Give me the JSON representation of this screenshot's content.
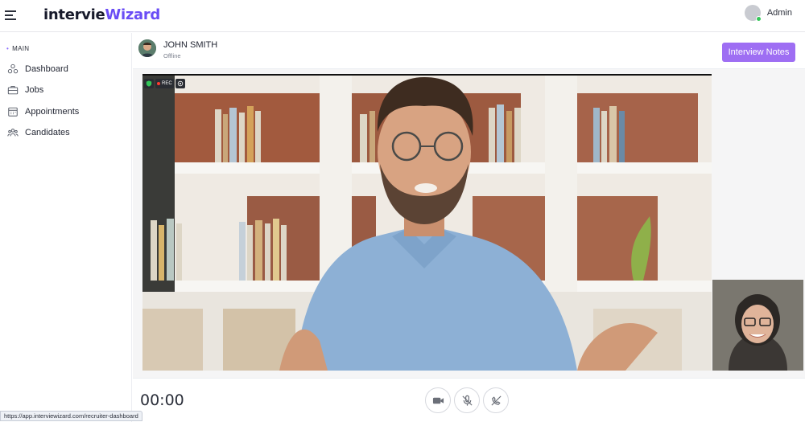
{
  "app": {
    "logo_part1": "intervie",
    "logo_part2": "Wizard",
    "brand_color": "#6a4df5"
  },
  "user": {
    "name": "Admin",
    "status_color": "#34c759"
  },
  "sidebar": {
    "section": "MAIN",
    "items": [
      {
        "label": "Dashboard",
        "icon": "dashboard-icon"
      },
      {
        "label": "Jobs",
        "icon": "briefcase-icon"
      },
      {
        "label": "Appointments",
        "icon": "calendar-icon"
      },
      {
        "label": "Candidates",
        "icon": "users-icon"
      }
    ]
  },
  "participant": {
    "name": "JOHN SMITH",
    "status": "Offline"
  },
  "toolbar": {
    "notes_label": "Interview Notes",
    "accent": "#9e6ef3"
  },
  "video": {
    "rec_label": "REC"
  },
  "call": {
    "timer": "00:00"
  },
  "statusbar": {
    "url": "https://app.interviewizard.com/recruiter-dashboard"
  }
}
